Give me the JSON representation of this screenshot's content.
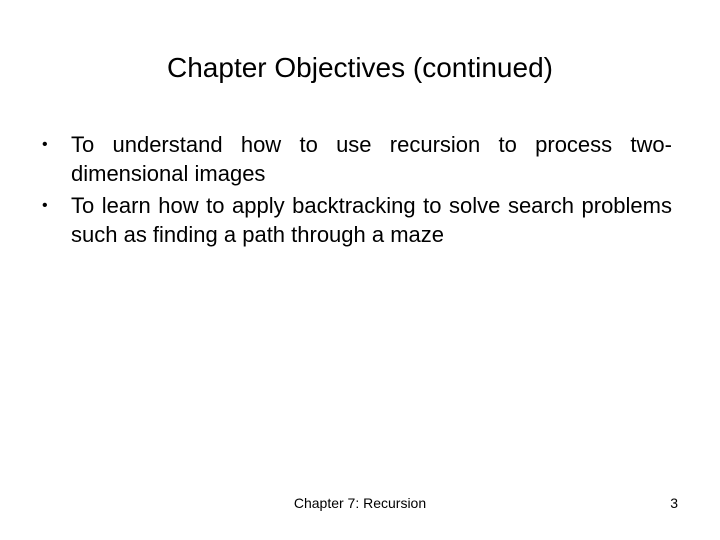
{
  "slide": {
    "title": "Chapter Objectives (continued)",
    "bullets": [
      {
        "marker": "•",
        "text": "To understand how to use recursion to process two-dimensional images"
      },
      {
        "marker": "•",
        "text": "To learn how to apply backtracking to solve search problems such as finding a path through a maze"
      }
    ],
    "footer": {
      "chapter": "Chapter 7: Recursion",
      "page_number": "3"
    }
  }
}
